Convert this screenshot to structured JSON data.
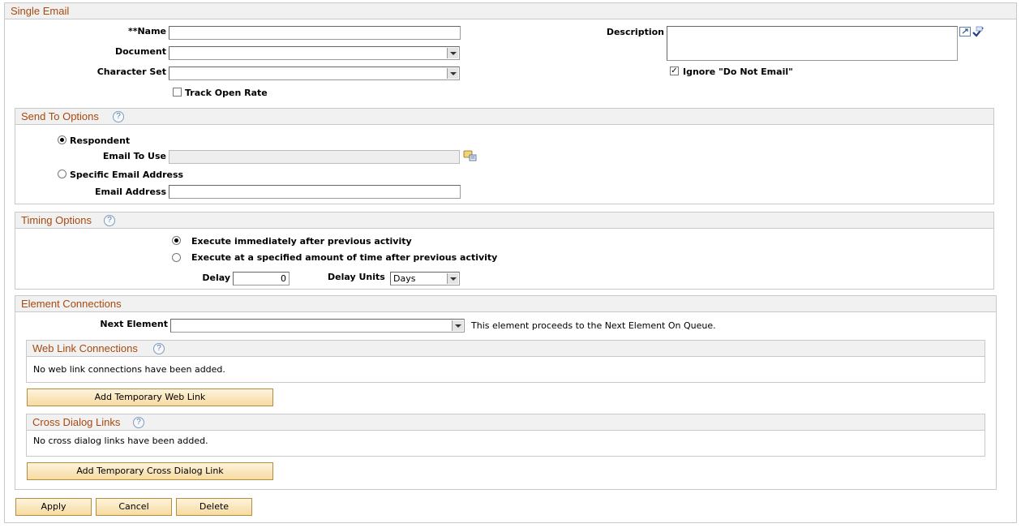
{
  "single_email": {
    "title": "Single Email",
    "name_label": "**Name",
    "name_value": "",
    "document_label": "Document",
    "document_value": "",
    "charset_label": "Character Set",
    "charset_value": "",
    "track_open_rate_label": "Track Open Rate",
    "track_open_rate_checked": false,
    "description_label": "Description",
    "description_value": "",
    "ignore_dne_label": "Ignore \"Do Not Email\"",
    "ignore_dne_checked": true
  },
  "send_to": {
    "title": "Send To Options",
    "help_glyph": "?",
    "respondent_label": "Respondent",
    "email_to_use_label": "Email To Use",
    "email_to_use_value": "",
    "specific_label": "Specific Email Address",
    "email_address_label": "Email Address",
    "email_address_value": "",
    "selected": "respondent"
  },
  "timing": {
    "title": "Timing Options",
    "help_glyph": "?",
    "immediate_label": "Execute immediately after previous activity",
    "delayed_label": "Execute at a specified amount of time after previous activity",
    "delay_label": "Delay",
    "delay_value": "0",
    "delay_units_label": "Delay Units",
    "delay_units_value": "Days",
    "selected": "immediate"
  },
  "connections": {
    "title": "Element Connections",
    "next_element_label": "Next Element",
    "next_element_value": "",
    "next_element_note": "This element proceeds to the Next Element On Queue.",
    "web_links": {
      "title": "Web Link Connections",
      "help_glyph": "?",
      "empty_text": "No web link connections have been added.",
      "add_button": "Add Temporary Web Link"
    },
    "cross_links": {
      "title": "Cross Dialog Links",
      "help_glyph": "?",
      "empty_text": "No cross dialog links have been added.",
      "add_button": "Add Temporary Cross Dialog Link"
    }
  },
  "actions": {
    "apply": "Apply",
    "cancel": "Cancel",
    "delete": "Delete"
  },
  "colors": {
    "section_title": "#a8490f",
    "button_fill": "#f7dba0",
    "header_bg": "#f1f1f1"
  }
}
